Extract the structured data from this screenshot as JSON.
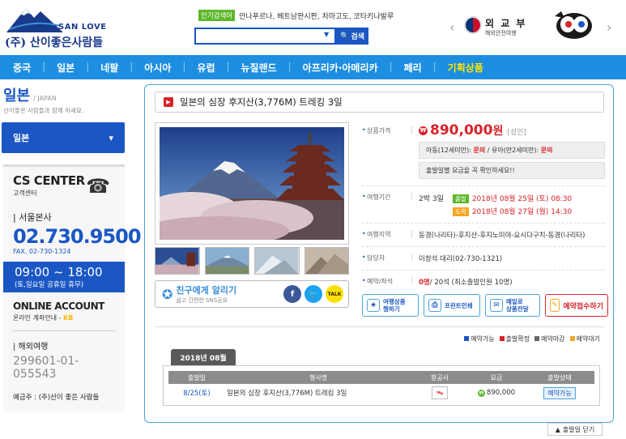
{
  "header": {
    "logo_en": "SAN LOVE",
    "logo_ko": "(주) 산이좋은사람들",
    "popular_tag": "인기검색어",
    "popular_keywords": "안나푸르나, 베트남판시판, 차마고도, 코타키나발루",
    "search_button": "검색",
    "mofa_title": "외 교 부",
    "mofa_sub": "해외안전여행"
  },
  "nav": {
    "items": [
      "중국",
      "일본",
      "네팔",
      "아시아",
      "유럽",
      "뉴질랜드",
      "아프리카·아메리카",
      "페리",
      "기획상품"
    ]
  },
  "sidebar": {
    "title": "일본",
    "title_en": "/ JAPAN",
    "subtitle": "산이좋은 사람들과 함께 하세요.",
    "category": "일본",
    "cs_title": "CS CENTER",
    "cs_sub": "고객센터",
    "office_label": "| 서울본사",
    "phone": "02.730.9500",
    "fax": "FAX.  02-730-1324",
    "hours": "09:00 ~ 18:00",
    "hours_note": "(토,일요일 공휴일 휴무)",
    "online_title": "ONLINE ACCOUNT",
    "online_sub": "온라인 계좌안내 -",
    "bank": "KB",
    "overseas_label": "| 해외여행",
    "account": "299601-01-055543",
    "depositor": "예금주 : (주)산이 좋은 사람들"
  },
  "product": {
    "title": "일본의 심장 후지산(3,776M) 트레킹 3일",
    "price_label": "상품가격",
    "price": "890,000",
    "price_unit": "원",
    "price_tag": "[성인]",
    "child_price": "아동(12세미만): ",
    "child_price_val": "문의",
    "infant_price": " / 유아(만2세미만): ",
    "infant_price_val": "문의",
    "fuel_note": "출발일별 요금을 꼭 확인하세요!!",
    "period_label": "여행기간",
    "period": "2박 3일",
    "dep_badge": "출발",
    "dep_date": "2018년 08월 25일 (토) 08:30",
    "arr_badge": "도착",
    "arr_date": "2018년 08월 27일 (월) 14:30",
    "region_label": "여행지역",
    "region": "동경(나리타)-후지산-후지노미야-요시다구치-동경(나리타)",
    "manager_label": "담당자",
    "manager": "이창석 대리(02-730-1321)",
    "seats_label": "예약/좌석",
    "seats_booked": "0명",
    "seats_rest": "/ 20석 (최소출발인원 10명)",
    "share_title": "친구에게 알리기",
    "share_sub": "쉽고 간편한 SNS공유",
    "sns_fb": "f",
    "sns_kakao": "TALK",
    "btn_wish": "여행상품\n찜하기",
    "btn_print": "프린트인쇄",
    "btn_mail": "메일로\n상품전달",
    "btn_reserve": "예약접수하기"
  },
  "legend": [
    "예약가능",
    "출발확정",
    "예약마감",
    "예약대기"
  ],
  "colors": {
    "legend": [
      "#1a56c4",
      "#d8232a",
      "#666666",
      "#f5a623"
    ]
  },
  "schedule": {
    "month_tab": "2018년 08월",
    "headers": [
      "출발일",
      "행사명",
      "항공사",
      "요금",
      "출발상태"
    ],
    "rows": [
      {
        "date": "8/25(토)",
        "name": "일본의 심장 후지산(3,776M) 트레킹 3일",
        "airline_icon": "airline-logo",
        "price": "890,000",
        "status": "예약가능"
      }
    ]
  },
  "close_button": "출발일 닫기"
}
